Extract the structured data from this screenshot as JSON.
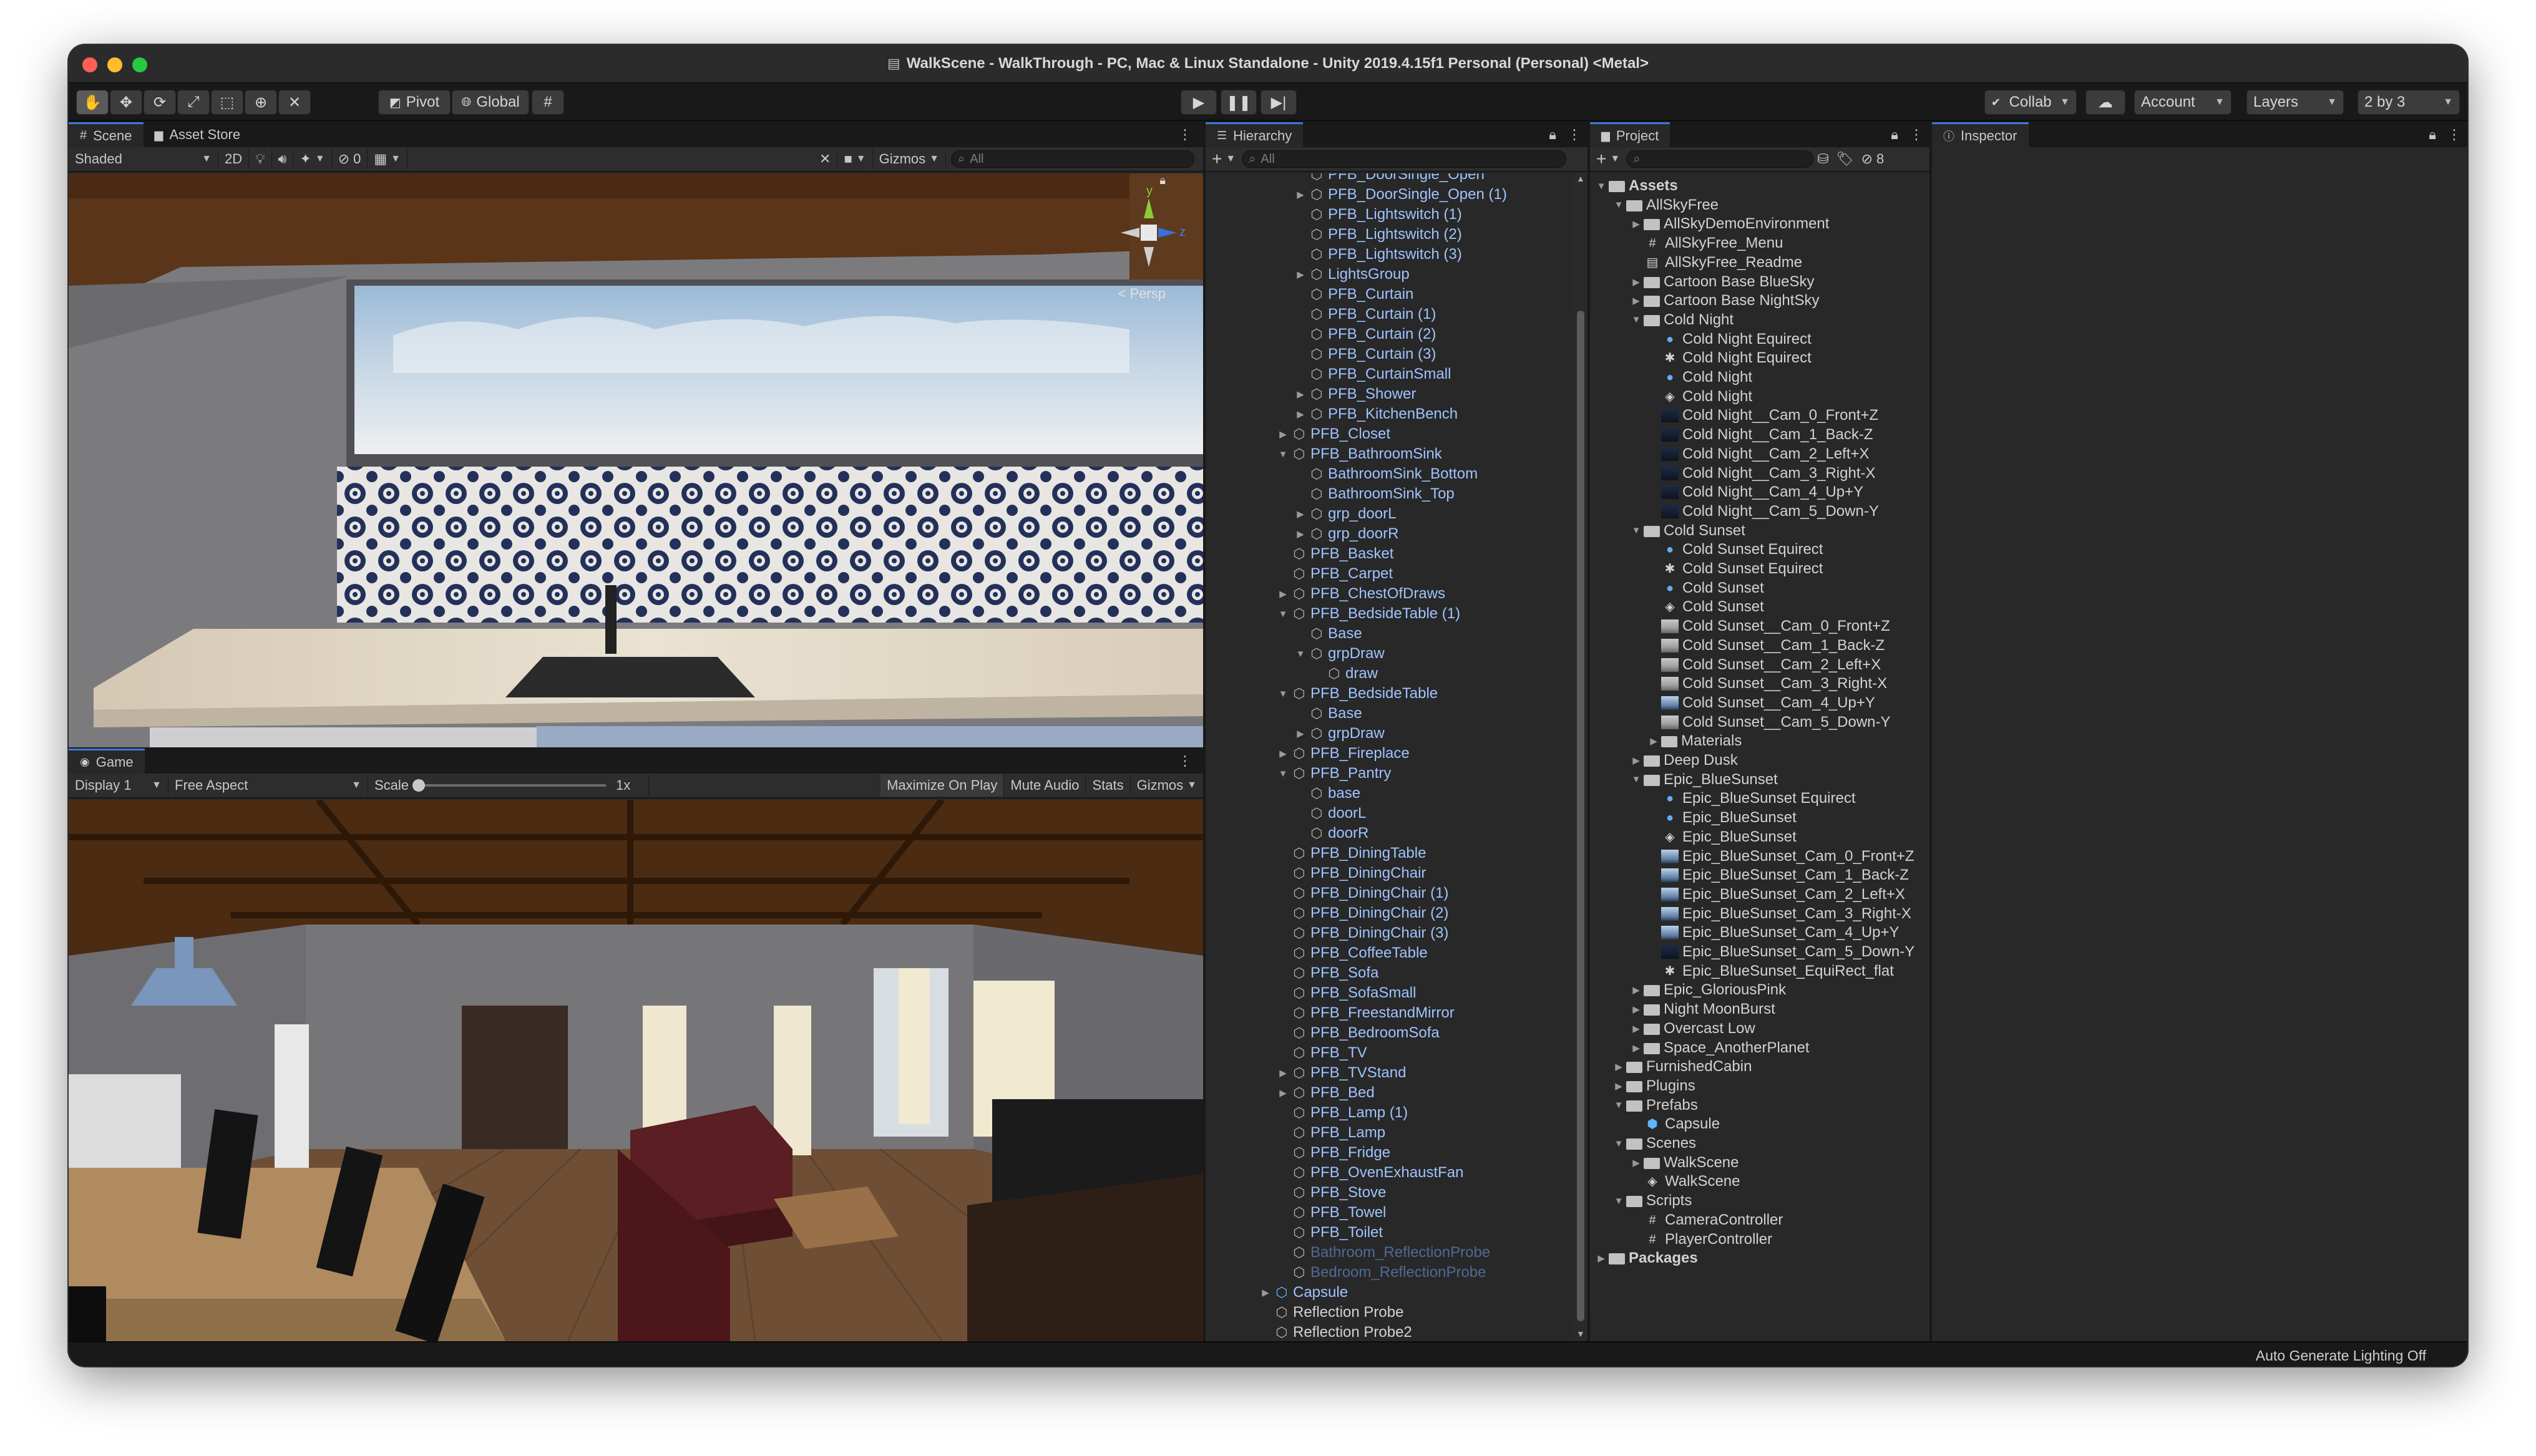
{
  "window": {
    "title": "WalkScene - WalkThrough - PC, Mac & Linux Standalone - Unity 2019.4.15f1 Personal (Personal) <Metal>"
  },
  "toolbar": {
    "pivot_label": "Pivot",
    "global_label": "Global",
    "collab_label": "Collab",
    "account_label": "Account",
    "layers_label": "Layers",
    "layout_label": "2 by 3"
  },
  "scene_panel": {
    "tabs": [
      "Scene",
      "Asset Store"
    ],
    "shading_mode": "Shaded",
    "mode_2d": "2D",
    "hidden_count": "0",
    "gizmos_label": "Gizmos",
    "search_placeholder": "All",
    "persp_label": "< Persp",
    "axis_y": "y",
    "axis_z": "z"
  },
  "game_panel": {
    "tab": "Game",
    "display": "Display 1",
    "aspect": "Free Aspect",
    "scale_label": "Scale",
    "scale_value": "1x",
    "scale_level": 0.0,
    "maximize_label": "Maximize On Play",
    "mute_label": "Mute Audio",
    "stats_label": "Stats",
    "gizmos_label": "Gizmos"
  },
  "hierarchy": {
    "tab": "Hierarchy",
    "search_placeholder": "All",
    "items": [
      {
        "label": "PFB_DoorSingle_Open",
        "depth": 2,
        "arrow": "",
        "style": "prefab"
      },
      {
        "label": "PFB_DoorSingle_Open (1)",
        "depth": 2,
        "arrow": "▶",
        "style": "prefab"
      },
      {
        "label": "PFB_Lightswitch (1)",
        "depth": 2,
        "arrow": "",
        "style": "prefab"
      },
      {
        "label": "PFB_Lightswitch (2)",
        "depth": 2,
        "arrow": "",
        "style": "prefab"
      },
      {
        "label": "PFB_Lightswitch (3)",
        "depth": 2,
        "arrow": "",
        "style": "prefab"
      },
      {
        "label": "LightsGroup",
        "depth": 2,
        "arrow": "▶",
        "style": "prefab"
      },
      {
        "label": "PFB_Curtain",
        "depth": 2,
        "arrow": "",
        "style": "prefab"
      },
      {
        "label": "PFB_Curtain (1)",
        "depth": 2,
        "arrow": "",
        "style": "prefab"
      },
      {
        "label": "PFB_Curtain (2)",
        "depth": 2,
        "arrow": "",
        "style": "prefab"
      },
      {
        "label": "PFB_Curtain (3)",
        "depth": 2,
        "arrow": "",
        "style": "prefab"
      },
      {
        "label": "PFB_CurtainSmall",
        "depth": 2,
        "arrow": "",
        "style": "prefab"
      },
      {
        "label": "PFB_Shower",
        "depth": 2,
        "arrow": "▶",
        "style": "prefab"
      },
      {
        "label": "PFB_KitchenBench",
        "depth": 2,
        "arrow": "▶",
        "style": "prefab"
      },
      {
        "label": "PFB_Closet",
        "depth": 1,
        "arrow": "▶",
        "style": "prefab"
      },
      {
        "label": "PFB_BathroomSink",
        "depth": 1,
        "arrow": "▼",
        "style": "prefab"
      },
      {
        "label": "BathroomSink_Bottom",
        "depth": 2,
        "arrow": "",
        "style": "prefab"
      },
      {
        "label": "BathroomSink_Top",
        "depth": 2,
        "arrow": "",
        "style": "prefab"
      },
      {
        "label": "grp_doorL",
        "depth": 2,
        "arrow": "▶",
        "style": "prefab"
      },
      {
        "label": "grp_doorR",
        "depth": 2,
        "arrow": "▶",
        "style": "prefab"
      },
      {
        "label": "PFB_Basket",
        "depth": 1,
        "arrow": "",
        "style": "prefab"
      },
      {
        "label": "PFB_Carpet",
        "depth": 1,
        "arrow": "",
        "style": "prefab"
      },
      {
        "label": "PFB_ChestOfDraws",
        "depth": 1,
        "arrow": "▶",
        "style": "prefab"
      },
      {
        "label": "PFB_BedsideTable (1)",
        "depth": 1,
        "arrow": "▼",
        "style": "prefab"
      },
      {
        "label": "Base",
        "depth": 2,
        "arrow": "",
        "style": "prefab"
      },
      {
        "label": "grpDraw",
        "depth": 2,
        "arrow": "▼",
        "style": "prefab"
      },
      {
        "label": "draw",
        "depth": 3,
        "arrow": "",
        "style": "prefab"
      },
      {
        "label": "PFB_BedsideTable",
        "depth": 1,
        "arrow": "▼",
        "style": "prefab"
      },
      {
        "label": "Base",
        "depth": 2,
        "arrow": "",
        "style": "prefab"
      },
      {
        "label": "grpDraw",
        "depth": 2,
        "arrow": "▶",
        "style": "prefab"
      },
      {
        "label": "PFB_Fireplace",
        "depth": 1,
        "arrow": "▶",
        "style": "prefab"
      },
      {
        "label": "PFB_Pantry",
        "depth": 1,
        "arrow": "▼",
        "style": "prefab"
      },
      {
        "label": "base",
        "depth": 2,
        "arrow": "",
        "style": "prefab"
      },
      {
        "label": "doorL",
        "depth": 2,
        "arrow": "",
        "style": "prefab"
      },
      {
        "label": "doorR",
        "depth": 2,
        "arrow": "",
        "style": "prefab"
      },
      {
        "label": "PFB_DiningTable",
        "depth": 1,
        "arrow": "",
        "style": "prefab"
      },
      {
        "label": "PFB_DiningChair",
        "depth": 1,
        "arrow": "",
        "style": "prefab"
      },
      {
        "label": "PFB_DiningChair (1)",
        "depth": 1,
        "arrow": "",
        "style": "prefab"
      },
      {
        "label": "PFB_DiningChair (2)",
        "depth": 1,
        "arrow": "",
        "style": "prefab"
      },
      {
        "label": "PFB_DiningChair (3)",
        "depth": 1,
        "arrow": "",
        "style": "prefab"
      },
      {
        "label": "PFB_CoffeeTable",
        "depth": 1,
        "arrow": "",
        "style": "prefab"
      },
      {
        "label": "PFB_Sofa",
        "depth": 1,
        "arrow": "",
        "style": "prefab"
      },
      {
        "label": "PFB_SofaSmall",
        "depth": 1,
        "arrow": "",
        "style": "prefab"
      },
      {
        "label": "PFB_FreestandMirror",
        "depth": 1,
        "arrow": "",
        "style": "prefab"
      },
      {
        "label": "PFB_BedroomSofa",
        "depth": 1,
        "arrow": "",
        "style": "prefab"
      },
      {
        "label": "PFB_TV",
        "depth": 1,
        "arrow": "",
        "style": "prefab"
      },
      {
        "label": "PFB_TVStand",
        "depth": 1,
        "arrow": "▶",
        "style": "prefab"
      },
      {
        "label": "PFB_Bed",
        "depth": 1,
        "arrow": "▶",
        "style": "prefab"
      },
      {
        "label": "PFB_Lamp (1)",
        "depth": 1,
        "arrow": "",
        "style": "prefab"
      },
      {
        "label": "PFB_Lamp",
        "depth": 1,
        "arrow": "",
        "style": "prefab"
      },
      {
        "label": "PFB_Fridge",
        "depth": 1,
        "arrow": "",
        "style": "prefab"
      },
      {
        "label": "PFB_OvenExhaustFan",
        "depth": 1,
        "arrow": "",
        "style": "prefab"
      },
      {
        "label": "PFB_Stove",
        "depth": 1,
        "arrow": "",
        "style": "prefab"
      },
      {
        "label": "PFB_Towel",
        "depth": 1,
        "arrow": "",
        "style": "prefab"
      },
      {
        "label": "PFB_Toilet",
        "depth": 1,
        "arrow": "",
        "style": "prefab"
      },
      {
        "label": "Bathroom_ReflectionProbe",
        "depth": 1,
        "arrow": "",
        "style": "faded"
      },
      {
        "label": "Bedroom_ReflectionProbe",
        "depth": 1,
        "arrow": "",
        "style": "faded"
      },
      {
        "label": "Capsule",
        "depth": 0,
        "arrow": "▶",
        "style": "prefab"
      },
      {
        "label": "Reflection Probe",
        "depth": 0,
        "arrow": "",
        "style": "plain"
      },
      {
        "label": "Reflection Probe2",
        "depth": 0,
        "arrow": "",
        "style": "plain"
      }
    ]
  },
  "project": {
    "tab": "Project",
    "hidden_count": "8",
    "items": [
      {
        "label": "Assets",
        "depth": 0,
        "arrow": "▼",
        "icon": "folder",
        "bold": true
      },
      {
        "label": "AllSkyFree",
        "depth": 1,
        "arrow": "▼",
        "icon": "folder"
      },
      {
        "label": "AllSkyDemoEnvironment",
        "depth": 2,
        "arrow": "▶",
        "icon": "folder"
      },
      {
        "label": "AllSkyFree_Menu",
        "depth": 2,
        "arrow": "",
        "icon": "script"
      },
      {
        "label": "AllSkyFree_Readme",
        "depth": 2,
        "arrow": "",
        "icon": "doc"
      },
      {
        "label": "Cartoon Base BlueSky",
        "depth": 2,
        "arrow": "▶",
        "icon": "folder"
      },
      {
        "label": "Cartoon Base NightSky",
        "depth": 2,
        "arrow": "▶",
        "icon": "folder"
      },
      {
        "label": "Cold Night",
        "depth": 2,
        "arrow": "▼",
        "icon": "folder"
      },
      {
        "label": "Cold Night Equirect",
        "depth": 3,
        "arrow": "",
        "icon": "material"
      },
      {
        "label": "Cold Night Equirect",
        "depth": 3,
        "arrow": "",
        "icon": "texture"
      },
      {
        "label": "Cold Night",
        "depth": 3,
        "arrow": "",
        "icon": "material"
      },
      {
        "label": "Cold Night",
        "depth": 3,
        "arrow": "",
        "icon": "unity"
      },
      {
        "label": "Cold Night__Cam_0_Front+Z",
        "depth": 3,
        "arrow": "",
        "icon": "thumbdark"
      },
      {
        "label": "Cold Night__Cam_1_Back-Z",
        "depth": 3,
        "arrow": "",
        "icon": "thumbdark"
      },
      {
        "label": "Cold Night__Cam_2_Left+X",
        "depth": 3,
        "arrow": "",
        "icon": "thumbdark"
      },
      {
        "label": "Cold Night__Cam_3_Right-X",
        "depth": 3,
        "arrow": "",
        "icon": "thumbdark"
      },
      {
        "label": "Cold Night__Cam_4_Up+Y",
        "depth": 3,
        "arrow": "",
        "icon": "thumbdark"
      },
      {
        "label": "Cold Night__Cam_5_Down-Y",
        "depth": 3,
        "arrow": "",
        "icon": "thumbdark"
      },
      {
        "label": "Cold Sunset",
        "depth": 2,
        "arrow": "▼",
        "icon": "folder"
      },
      {
        "label": "Cold Sunset Equirect",
        "depth": 3,
        "arrow": "",
        "icon": "material"
      },
      {
        "label": "Cold Sunset Equirect",
        "depth": 3,
        "arrow": "",
        "icon": "texture"
      },
      {
        "label": "Cold Sunset",
        "depth": 3,
        "arrow": "",
        "icon": "material"
      },
      {
        "label": "Cold Sunset",
        "depth": 3,
        "arrow": "",
        "icon": "unity"
      },
      {
        "label": "Cold Sunset__Cam_0_Front+Z",
        "depth": 3,
        "arrow": "",
        "icon": "thumbsun"
      },
      {
        "label": "Cold Sunset__Cam_1_Back-Z",
        "depth": 3,
        "arrow": "",
        "icon": "thumbsun"
      },
      {
        "label": "Cold Sunset__Cam_2_Left+X",
        "depth": 3,
        "arrow": "",
        "icon": "thumbsun"
      },
      {
        "label": "Cold Sunset__Cam_3_Right-X",
        "depth": 3,
        "arrow": "",
        "icon": "thumbsun"
      },
      {
        "label": "Cold Sunset__Cam_4_Up+Y",
        "depth": 3,
        "arrow": "",
        "icon": "thumb"
      },
      {
        "label": "Cold Sunset__Cam_5_Down-Y",
        "depth": 3,
        "arrow": "",
        "icon": "thumbsun"
      },
      {
        "label": "Materials",
        "depth": 3,
        "arrow": "▶",
        "icon": "folder"
      },
      {
        "label": "Deep Dusk",
        "depth": 2,
        "arrow": "▶",
        "icon": "folder"
      },
      {
        "label": "Epic_BlueSunset",
        "depth": 2,
        "arrow": "▼",
        "icon": "folder"
      },
      {
        "label": "Epic_BlueSunset Equirect",
        "depth": 3,
        "arrow": "",
        "icon": "material"
      },
      {
        "label": "Epic_BlueSunset",
        "depth": 3,
        "arrow": "",
        "icon": "material"
      },
      {
        "label": "Epic_BlueSunset",
        "depth": 3,
        "arrow": "",
        "icon": "unity"
      },
      {
        "label": "Epic_BlueSunset_Cam_0_Front+Z",
        "depth": 3,
        "arrow": "",
        "icon": "thumb"
      },
      {
        "label": "Epic_BlueSunset_Cam_1_Back-Z",
        "depth": 3,
        "arrow": "",
        "icon": "thumb"
      },
      {
        "label": "Epic_BlueSunset_Cam_2_Left+X",
        "depth": 3,
        "arrow": "",
        "icon": "thumb"
      },
      {
        "label": "Epic_BlueSunset_Cam_3_Right-X",
        "depth": 3,
        "arrow": "",
        "icon": "thumb"
      },
      {
        "label": "Epic_BlueSunset_Cam_4_Up+Y",
        "depth": 3,
        "arrow": "",
        "icon": "thumb"
      },
      {
        "label": "Epic_BlueSunset_Cam_5_Down-Y",
        "depth": 3,
        "arrow": "",
        "icon": "thumbdark"
      },
      {
        "label": "Epic_BlueSunset_EquiRect_flat",
        "depth": 3,
        "arrow": "",
        "icon": "texture"
      },
      {
        "label": "Epic_GloriousPink",
        "depth": 2,
        "arrow": "▶",
        "icon": "folder"
      },
      {
        "label": "Night MoonBurst",
        "depth": 2,
        "arrow": "▶",
        "icon": "folder"
      },
      {
        "label": "Overcast Low",
        "depth": 2,
        "arrow": "▶",
        "icon": "folder"
      },
      {
        "label": "Space_AnotherPlanet",
        "depth": 2,
        "arrow": "▶",
        "icon": "folder"
      },
      {
        "label": "FurnishedCabin",
        "depth": 1,
        "arrow": "▶",
        "icon": "folder"
      },
      {
        "label": "Plugins",
        "depth": 1,
        "arrow": "▶",
        "icon": "folder"
      },
      {
        "label": "Prefabs",
        "depth": 1,
        "arrow": "▼",
        "icon": "folder"
      },
      {
        "label": "Capsule",
        "depth": 2,
        "arrow": "",
        "icon": "prefab"
      },
      {
        "label": "Scenes",
        "depth": 1,
        "arrow": "▼",
        "icon": "folder"
      },
      {
        "label": "WalkScene",
        "depth": 2,
        "arrow": "▶",
        "icon": "folder"
      },
      {
        "label": "WalkScene",
        "depth": 2,
        "arrow": "",
        "icon": "unity"
      },
      {
        "label": "Scripts",
        "depth": 1,
        "arrow": "▼",
        "icon": "folder"
      },
      {
        "label": "CameraController",
        "depth": 2,
        "arrow": "",
        "icon": "script"
      },
      {
        "label": "PlayerController",
        "depth": 2,
        "arrow": "",
        "icon": "script"
      },
      {
        "label": "Packages",
        "depth": 0,
        "arrow": "▶",
        "icon": "folder",
        "bold": true
      }
    ]
  },
  "inspector": {
    "tab": "Inspector"
  },
  "status": {
    "text": "Auto Generate Lighting Off"
  },
  "colors": {
    "accent": "#3d7ae0",
    "prefab_text": "#9fc3ff",
    "window_bg": "#191919",
    "panel_bg": "#282828"
  }
}
